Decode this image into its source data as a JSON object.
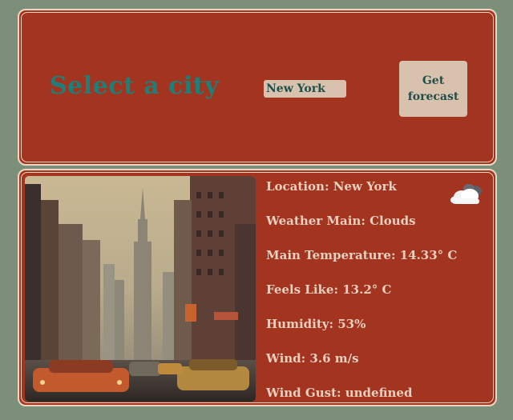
{
  "header": {
    "title": "Select a city",
    "city_input_value": "New York",
    "forecast_button_label": "Get forecast"
  },
  "weather": {
    "icon": "cloud-icon",
    "image_alt": "city-photo",
    "rows": [
      "Location: New York",
      "Weather Main: Clouds",
      "Main Temperature: 14.33° C",
      "Feels Like: 13.2° C",
      "Humidity: 53%",
      "Wind: 3.6 m/s",
      "Wind Gust: undefined"
    ]
  },
  "colors": {
    "background": "#7c9079",
    "panel": "#a33420",
    "panel_border": "#ecd7c5",
    "title": "#1f7f78",
    "control": "#d8c2ae",
    "control_text": "#1f4f4a",
    "info_text": "#e9cfbe"
  }
}
